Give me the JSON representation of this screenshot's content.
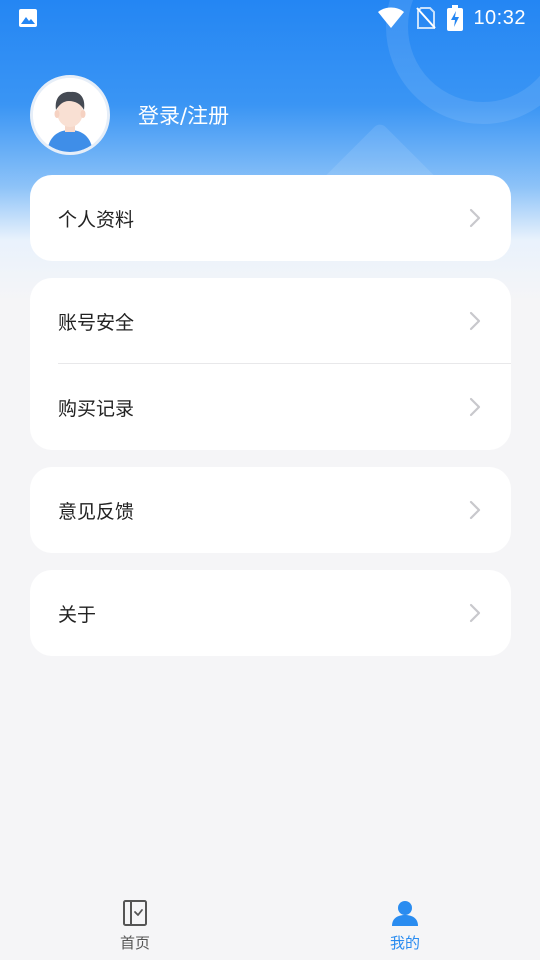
{
  "status_bar": {
    "time": "10:32",
    "icons": [
      "gallery-icon",
      "wifi-icon",
      "no-sim-icon",
      "battery-charging-icon"
    ]
  },
  "profile": {
    "avatar_icon": "default-avatar",
    "login_label": "登录/注册"
  },
  "menu": {
    "personal_info": "个人资料",
    "account_security": "账号安全",
    "purchase_history": "购买记录",
    "feedback": "意见反馈",
    "about": "关于",
    "chevron_icon": "chevron-right-icon"
  },
  "tabbar": {
    "home_label": "首页",
    "home_icon": "book-icon",
    "mine_label": "我的",
    "mine_icon": "person-icon",
    "active_tab": "我的"
  },
  "colors": {
    "brand": "#2486f3",
    "active_tab": "#2a8cf0",
    "inactive_tab": "#555555",
    "chevron": "#c8c8cc",
    "background": "#f5f5f7"
  }
}
